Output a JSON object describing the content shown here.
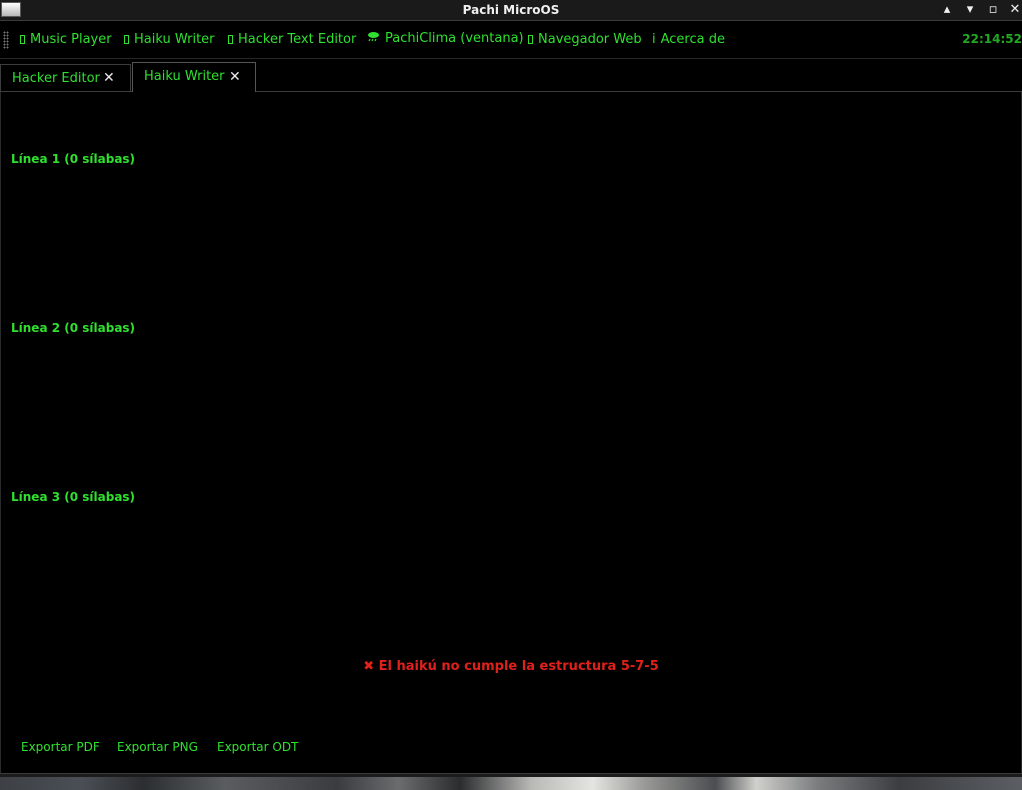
{
  "window": {
    "title": "Pachi MicroOS",
    "controls": [
      "▴",
      "▾",
      "▫",
      "✕"
    ]
  },
  "toolbar": {
    "items": [
      {
        "icon": "music-icon",
        "label": "Music Player"
      },
      {
        "icon": "haiku-icon",
        "label": "Haiku Writer"
      },
      {
        "icon": "terminal-icon",
        "label": "Hacker Text Editor"
      },
      {
        "icon": "weather-icon",
        "label": "PachiClima (ventana)"
      },
      {
        "icon": "globe-icon",
        "label": "Navegador Web"
      },
      {
        "icon": "info-icon",
        "label": "Acerca de"
      }
    ],
    "clock": "22:14:52"
  },
  "tabs": [
    {
      "label": "Hacker Editor",
      "active": false
    },
    {
      "label": "Haiku Writer",
      "active": true
    }
  ],
  "haiku": {
    "line1_label": "Línea 1 (0 sílabas)",
    "line2_label": "Línea 2 (0 sílabas)",
    "line3_label": "Línea 3 (0 sílabas)",
    "status": "✖ El haikú no cumple la estructura 5-7-5"
  },
  "export": {
    "pdf": "Exportar PDF",
    "png": "Exportar PNG",
    "odt": "Exportar ODT"
  },
  "colors": {
    "accent": "#2fe02f",
    "error": "#e0201a",
    "background": "#000000"
  }
}
